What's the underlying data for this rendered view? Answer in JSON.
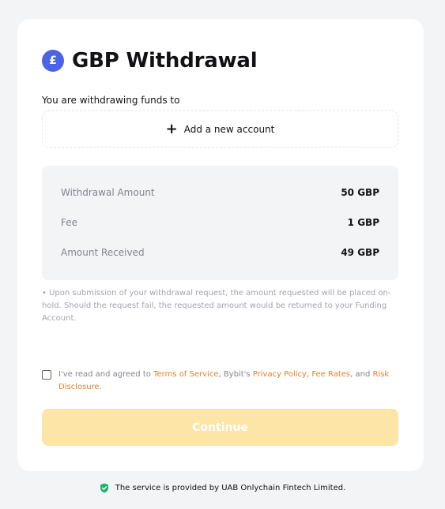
{
  "header": {
    "currency_symbol": "£",
    "title": "GBP Withdrawal"
  },
  "destination": {
    "label": "You are withdrawing funds to",
    "add_account": "Add a new account"
  },
  "summary": [
    {
      "label": "Withdrawal Amount",
      "value": "50 GBP"
    },
    {
      "label": "Fee",
      "value": "1 GBP"
    },
    {
      "label": "Amount Received",
      "value": "49 GBP"
    }
  ],
  "note": "Upon submission of your withdrawal request, the amount requested will be placed on-hold. Should the request fail, the requested amount would be returned to your Funding Account.",
  "agreement": {
    "prefix": "I've read and agreed to ",
    "terms": "Terms of Service",
    "mid1": ", Bybit's ",
    "privacy": "Privacy Policy",
    "mid2": ", ",
    "fees": "Fee Rates",
    "mid3": ", and ",
    "risk": "Risk Disclosure",
    "suffix": "."
  },
  "continue_label": "Continue",
  "footer_text": "The service is provided by UAB Onlychain Fintech Limited.",
  "colors": {
    "accent": "#e2812b",
    "icon_blue": "#4b63e6",
    "button_disabled": "#fde4a7",
    "shield_green": "#20b26c"
  },
  "icons": {
    "currency": "pound-icon",
    "add": "plus-icon",
    "footer": "shield-check-icon"
  }
}
